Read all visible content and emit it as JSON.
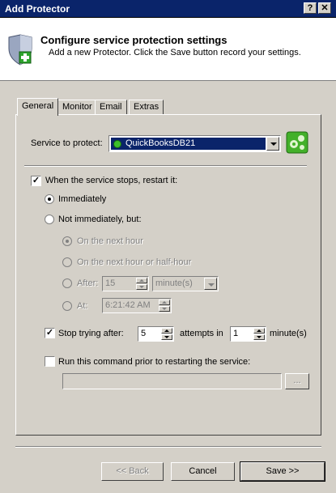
{
  "window": {
    "title": "Add Protector",
    "help_button": "?",
    "close_button": "✕"
  },
  "header": {
    "title": "Configure service protection settings",
    "subtitle": "Add a new Protector. Click the Save button record your settings.",
    "icon": "shield-plus-icon"
  },
  "tabs": [
    {
      "label": "General",
      "active": true
    },
    {
      "label": "Monitor",
      "active": false
    },
    {
      "label": "Email",
      "active": false
    },
    {
      "label": "Extras",
      "active": false
    }
  ],
  "general": {
    "service_label": "Service to protect:",
    "service_value": "QuickBooksDB21",
    "service_status_color": "#3cbf2a",
    "services_button_icon": "services-icon",
    "restart_checkbox_label": "When the service stops, restart it:",
    "restart_checked": true,
    "immediately_label": "Immediately",
    "not_immediately_label": "Not immediately, but:",
    "next_hour_label": "On the next hour",
    "next_half_hour_label": "On the next hour or half-hour",
    "after_label": "After:",
    "after_value": "15",
    "after_unit": "minute(s)",
    "at_label": "At:",
    "at_value": "6:21:42 AM",
    "stop_trying_label": "Stop trying after:",
    "stop_trying_checked": true,
    "stop_trying_value": "5",
    "attempts_in_label": "attempts in",
    "attempts_in_value": "1",
    "minutes_label": "minute(s)",
    "run_command_label": "Run this command prior to restarting the service:",
    "run_command_checked": false,
    "command_value": "",
    "browse_label": "..."
  },
  "footer": {
    "back_label": "<< Back",
    "cancel_label": "Cancel",
    "save_label": "Save >>"
  }
}
